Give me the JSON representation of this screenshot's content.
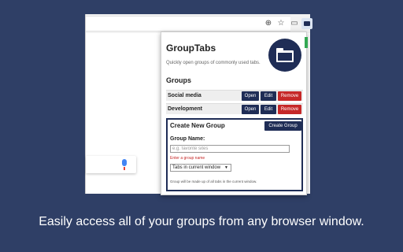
{
  "popup": {
    "title": "GroupTabs",
    "subtitle": "Quickly open groups of commonly used tabs.",
    "groups_heading": "Groups",
    "groups": [
      {
        "name": "Social media",
        "open_label": "Open",
        "edit_label": "Edit",
        "remove_label": "Remove"
      },
      {
        "name": "Development",
        "open_label": "Open",
        "edit_label": "Edit",
        "remove_label": "Remove"
      }
    ],
    "create": {
      "title": "Create New Group",
      "button_label": "Create Group",
      "name_label": "Group Name:",
      "name_placeholder": "e.g. favorite sites",
      "name_value": "",
      "error_text": "Enter a group name",
      "select_value": "Tabs in current window",
      "help_text": "Group will be made up of all tabs in the current window."
    }
  },
  "caption": "Easily access all of your groups from any browser window.",
  "icons": {
    "toolbar": [
      "zoom-icon",
      "star-icon",
      "extension-icon",
      "grouptabs-icon"
    ],
    "logo": "folder-icon",
    "search": "microphone-icon"
  },
  "colors": {
    "background": "#2f3f66",
    "brand": "#1f2d56",
    "remove": "#c62828"
  }
}
